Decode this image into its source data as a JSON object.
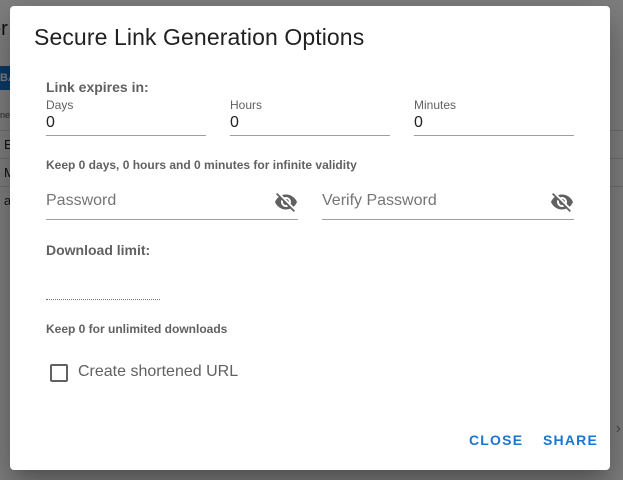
{
  "background": {
    "title_fragment": "er",
    "chip_fragment": "BA",
    "small_fragment": "ne",
    "rows": [
      "E",
      "M",
      "a"
    ]
  },
  "dialog": {
    "title": "Secure Link Generation Options",
    "expiry": {
      "label": "Link expires in:",
      "days": {
        "label": "Days",
        "value": "0"
      },
      "hours": {
        "label": "Hours",
        "value": "0"
      },
      "minutes": {
        "label": "Minutes",
        "value": "0"
      },
      "hint": "Keep 0 days, 0 hours and 0 minutes for infinite validity"
    },
    "password": {
      "placeholder": "Password",
      "icon": "visibility-off-icon"
    },
    "verify_password": {
      "placeholder": "Verify Password",
      "icon": "visibility-off-icon"
    },
    "download_limit": {
      "label": "Download limit:",
      "value": "",
      "hint": "Keep 0 for unlimited downloads"
    },
    "shortened_url": {
      "label": "Create shortened URL",
      "checked": false
    },
    "actions": {
      "close": "CLOSE",
      "share": "SHARE"
    }
  },
  "colors": {
    "accent": "#1976d2",
    "overlay": "rgba(0,0,0,0.5)"
  }
}
